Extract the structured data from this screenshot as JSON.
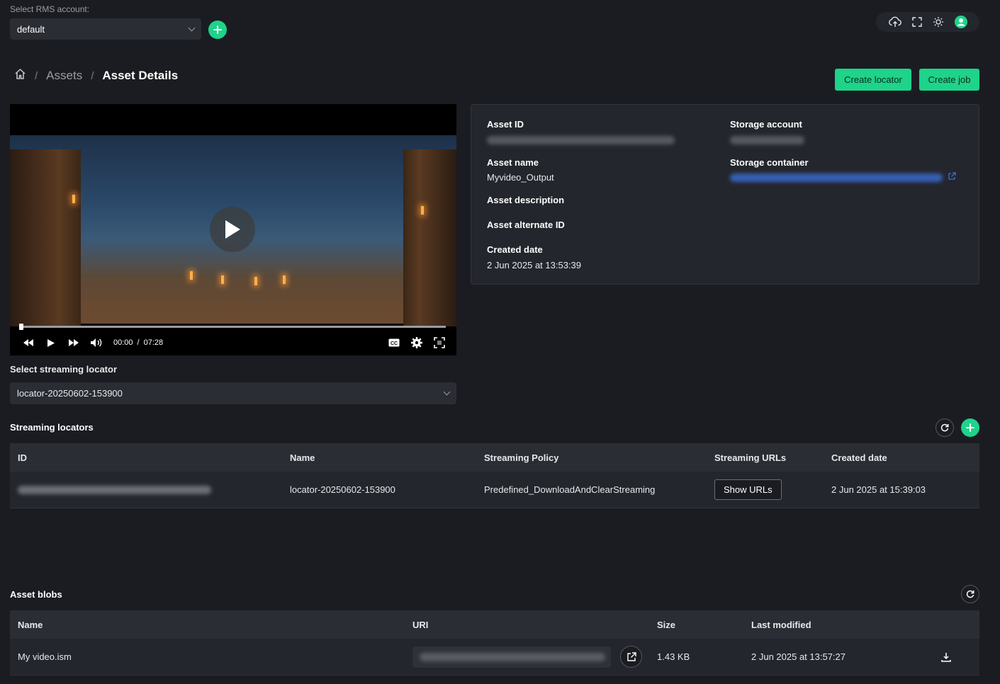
{
  "top": {
    "rms_label": "Select RMS account:",
    "rms_value": "default",
    "icons": [
      "cloud-upload-icon",
      "fullscreen-icon",
      "theme-sun-icon",
      "user-avatar-icon"
    ]
  },
  "breadcrumb": {
    "assets": "Assets",
    "current": "Asset Details"
  },
  "actions": {
    "create_locator": "Create locator",
    "create_job": "Create job"
  },
  "video": {
    "current_time": "00:00",
    "separator": "/",
    "duration": "07:28",
    "progress": 0
  },
  "details": {
    "asset_id_label": "Asset ID",
    "asset_name_label": "Asset name",
    "asset_name": "Myvideo_Output",
    "asset_description_label": "Asset description",
    "asset_alternate_id_label": "Asset alternate ID",
    "created_date_label": "Created date",
    "created_date": "2 Jun 2025 at 13:53:39",
    "storage_account_label": "Storage account",
    "storage_container_label": "Storage container"
  },
  "locator_select": {
    "label": "Select streaming locator",
    "value": "locator-20250602-153900"
  },
  "streaming_locators": {
    "title": "Streaming locators",
    "columns": [
      "ID",
      "Name",
      "Streaming Policy",
      "Streaming URLs",
      "Created date"
    ],
    "rows": [
      {
        "name": "locator-20250602-153900",
        "policy": "Predefined_DownloadAndClearStreaming",
        "urls_button": "Show URLs",
        "created": "2 Jun 2025 at 15:39:03"
      }
    ]
  },
  "asset_blobs": {
    "title": "Asset blobs",
    "columns": [
      "Name",
      "URI",
      "Size",
      "Last modified"
    ],
    "rows": [
      {
        "name": "My video.ism",
        "size": "1.43 KB",
        "modified": "2 Jun 2025 at 13:57:27"
      }
    ]
  },
  "colors": {
    "accent": "#1ed38a",
    "background": "#1b1c22",
    "panel": "#24262d",
    "link": "#3a6fd6"
  }
}
